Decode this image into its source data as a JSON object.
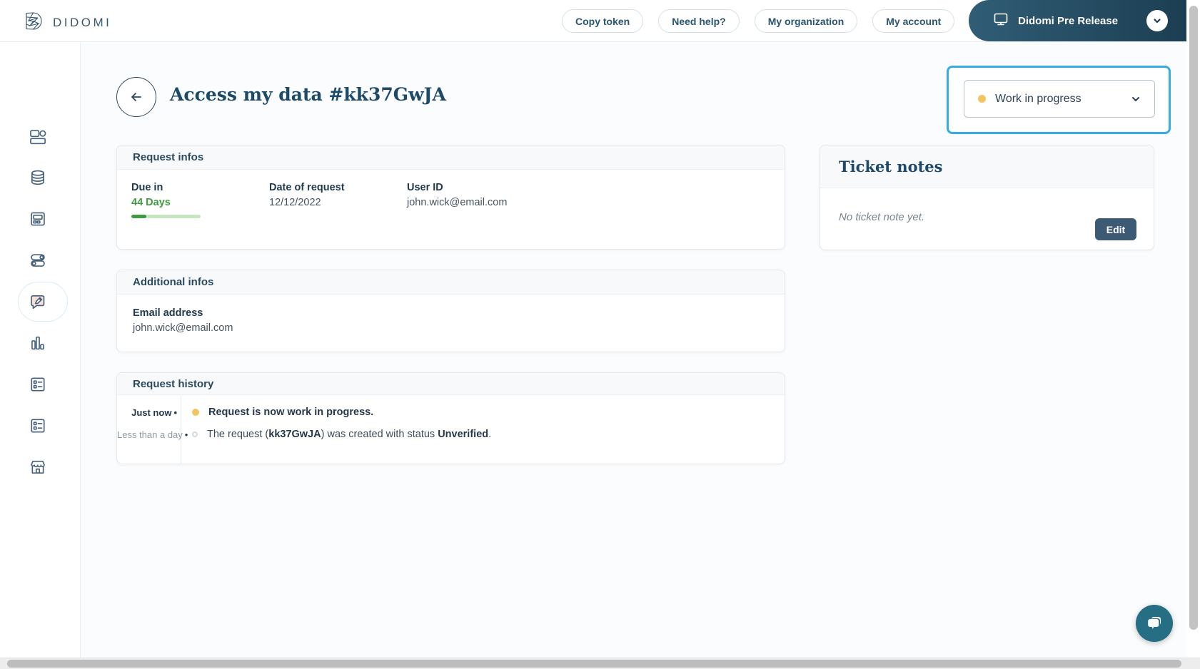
{
  "header": {
    "logo_text": "DIDOMI",
    "nav": [
      {
        "label": "Copy token"
      },
      {
        "label": "Need help?"
      },
      {
        "label": "My organization"
      },
      {
        "label": "My account"
      }
    ],
    "environment": {
      "label": "Didomi Pre Release",
      "icon": "monitor-icon",
      "expander_icon": "chevron-down-icon"
    }
  },
  "sidebar": {
    "items": [
      {
        "icon": "dashboard-icon",
        "active": false
      },
      {
        "icon": "database-icon",
        "active": false
      },
      {
        "icon": "widget-console-icon",
        "active": false
      },
      {
        "icon": "toggles-icon",
        "active": false
      },
      {
        "icon": "message-edit-icon",
        "active": true
      },
      {
        "icon": "bar-chart-icon",
        "active": false
      },
      {
        "icon": "form-list-icon",
        "active": false
      },
      {
        "icon": "form-list-icon",
        "active": false
      },
      {
        "icon": "storefront-icon",
        "active": false
      }
    ]
  },
  "page": {
    "title": "Access my data #kk37GwJA",
    "back_icon": "arrow-left-icon",
    "status_dropdown": {
      "selected": "Work in progress",
      "dot_color": "#f2c55f",
      "highlight_border_color": "#36ace2"
    }
  },
  "request_infos": {
    "title": "Request infos",
    "due": {
      "label": "Due in",
      "value": "44 Days",
      "progress_percent": 22,
      "color": "#3f9a42"
    },
    "date": {
      "label": "Date of request",
      "value": "12/12/2022"
    },
    "user": {
      "label": "User ID",
      "value": "john.wick@email.com"
    }
  },
  "additional_infos": {
    "title": "Additional infos",
    "email": {
      "label": "Email address",
      "value": "john.wick@email.com"
    }
  },
  "request_history": {
    "title": "Request history",
    "events": [
      {
        "time": "Just now",
        "bullet": "•",
        "dot": "yellow",
        "message": "Request is now work in progress."
      },
      {
        "time": "Less than a day",
        "bullet": "•",
        "dot": "gray",
        "parts": {
          "prefix": "The request (",
          "code": "kk37GwJA",
          "middle": ") was created with status ",
          "status": "Unverified",
          "suffix": "."
        }
      }
    ]
  },
  "ticket_notes": {
    "title": "Ticket notes",
    "empty_text": "No ticket note yet.",
    "edit_label": "Edit"
  },
  "colors": {
    "accent_blue": "#36ace2",
    "status_yellow": "#f2c55f",
    "success_green": "#3f9a42",
    "navy": "#1d4a68",
    "button_navy": "#3c5a74",
    "chat_teal": "#256e84"
  }
}
